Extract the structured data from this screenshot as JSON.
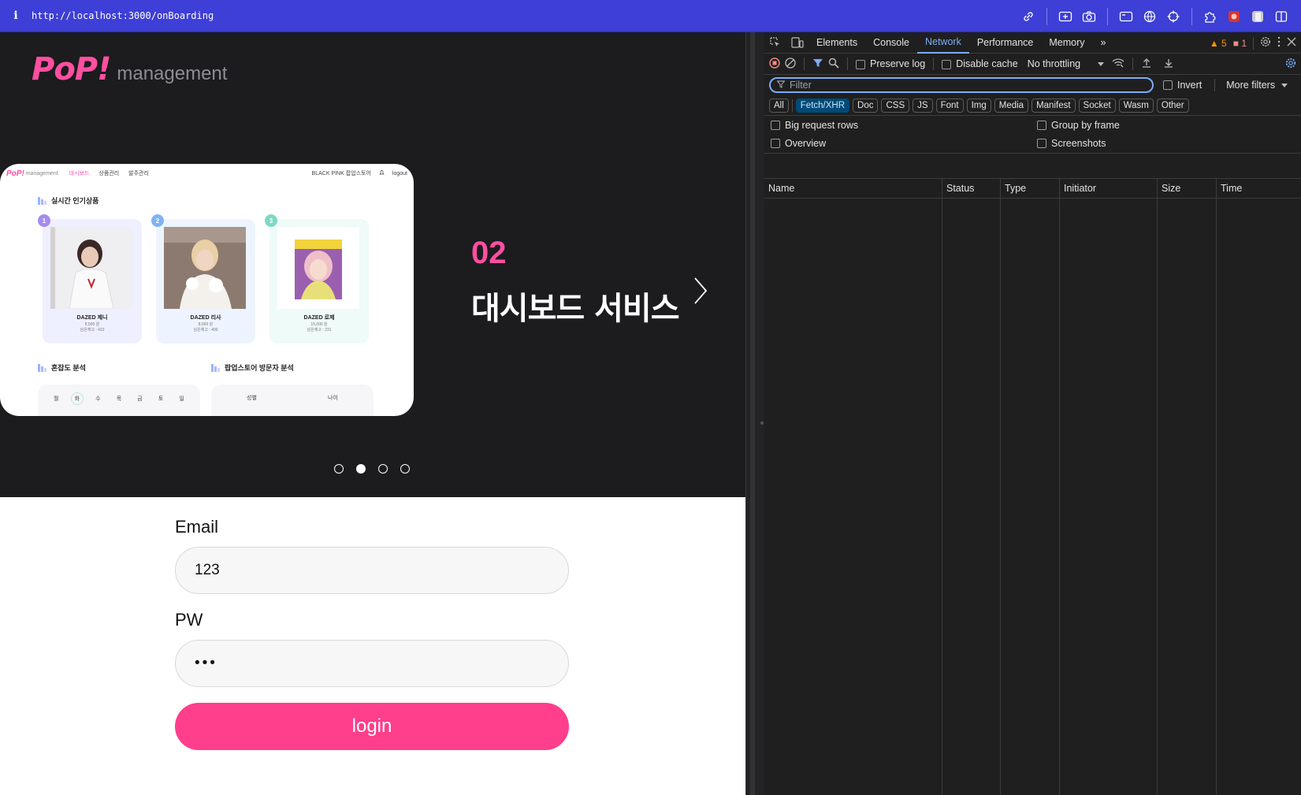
{
  "browser": {
    "info_glyph": "i",
    "url": "http://localhost:3000/onBoarding"
  },
  "hero": {
    "logo_pop": "PoP!",
    "logo_management": "management",
    "slide_number": "02",
    "slide_title": "대시보드 서비스",
    "dots_total": 4,
    "dots_active": 2
  },
  "preview": {
    "nav": {
      "logo": "PoP!",
      "logo_sub": "management",
      "links": [
        "대시보드",
        "상품관리",
        "발주관리"
      ],
      "store": "BLACK PINK 팝업스토어",
      "logout": "logout"
    },
    "section_popular": "실시간 인기상품",
    "products": [
      {
        "rank": "1",
        "name": "DAZED 제니",
        "price": "8,500 원",
        "stock": "남은재고 : 410",
        "color": "#a48cf0",
        "bg": "#eef0ff"
      },
      {
        "rank": "2",
        "name": "DAZED 리사",
        "price": "8,000 원",
        "stock": "남은재고 : 400",
        "color": "#7fb3f5",
        "bg": "#edf4ff"
      },
      {
        "rank": "3",
        "name": "DAZED 로제",
        "price": "15,000 원",
        "stock": "남은재고 : 231",
        "color": "#7ed8c5",
        "bg": "#eefbf8"
      }
    ],
    "section_congestion": "혼잡도 분석",
    "section_visitors": "팝업스토어 방문자 분석",
    "days": [
      "월",
      "화",
      "수",
      "목",
      "금",
      "토",
      "일"
    ],
    "gender_tabs": [
      "성별",
      "나이"
    ]
  },
  "login_form": {
    "email_label": "Email",
    "email_value": "123",
    "pw_label": "PW",
    "pw_value": "•••",
    "login_label": "login"
  },
  "devtools": {
    "tabs": [
      "Elements",
      "Console",
      "Network",
      "Performance",
      "Memory"
    ],
    "active_tab": "Network",
    "more_tabs": "»",
    "warnings": "5",
    "errors": "1",
    "toolbar": {
      "preserve_log": "Preserve log",
      "disable_cache": "Disable cache",
      "throttling": "No throttling"
    },
    "filter_placeholder": "Filter",
    "invert": "Invert",
    "more_filters": "More filters",
    "type_filters": [
      "All",
      "Fetch/XHR",
      "Doc",
      "CSS",
      "JS",
      "Font",
      "Img",
      "Media",
      "Manifest",
      "Socket",
      "Wasm",
      "Other"
    ],
    "active_filter": "Fetch/XHR",
    "options": {
      "big_request_rows": "Big request rows",
      "group_by_frame": "Group by frame",
      "overview": "Overview",
      "screenshots": "Screenshots"
    },
    "columns": [
      "Name",
      "Status",
      "Type",
      "Initiator",
      "Size",
      "Time"
    ]
  },
  "colors": {
    "url_bar": "#3d3fd6",
    "brand_pink": "#ff4fa0",
    "login_button": "#ff3e8c",
    "devtools_accent": "#7cacf8"
  }
}
